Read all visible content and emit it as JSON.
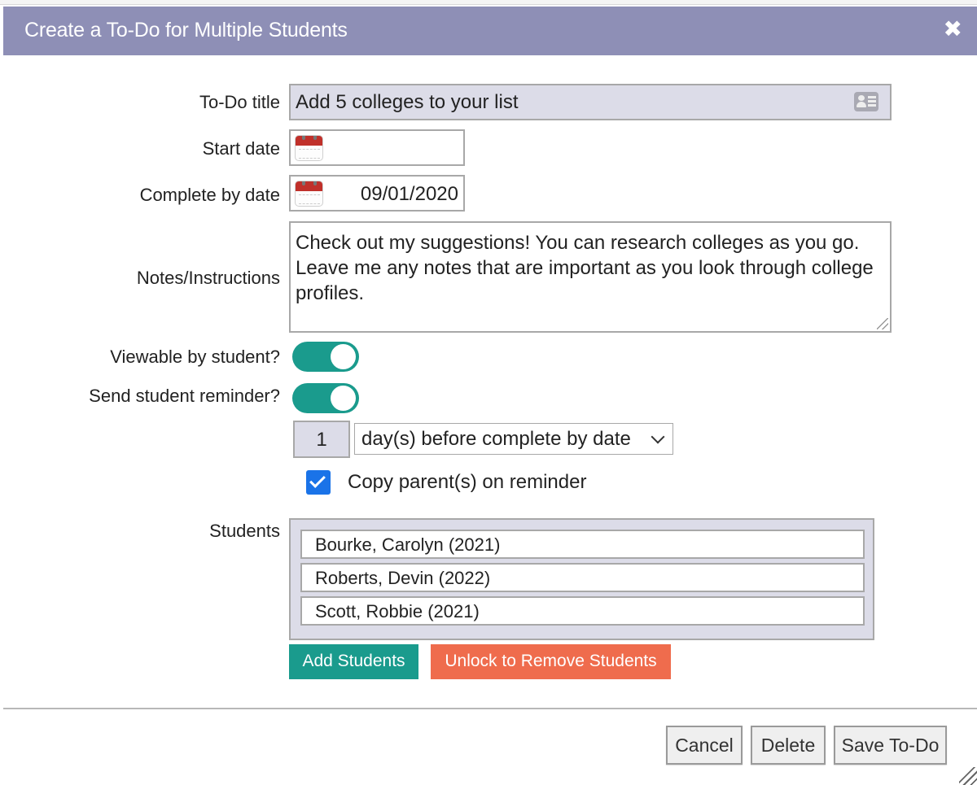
{
  "dialog": {
    "title": "Create a To-Do for Multiple Students",
    "close_symbol": "✖"
  },
  "form": {
    "todo_title_label": "To-Do title",
    "todo_title_value": "Add 5 colleges to your list",
    "start_date_label": "Start date",
    "start_date_value": "",
    "complete_by_label": "Complete by date",
    "complete_by_value": "09/01/2020",
    "notes_label": "Notes/Instructions",
    "notes_value": "Check out my suggestions! You can research colleges as you go. Leave me any notes that are important as you look through college profiles.",
    "viewable_label": "Viewable by student?",
    "viewable_on": true,
    "reminder_label": "Send student reminder?",
    "reminder_on": true,
    "reminder_days_value": "1",
    "reminder_timing_selected": "day(s) before complete by date",
    "copy_parents_label": "Copy parent(s) on reminder",
    "copy_parents_checked": true,
    "students_label": "Students"
  },
  "students": [
    "Bourke, Carolyn (2021)",
    "Roberts, Devin (2022)",
    "Scott, Robbie (2021)"
  ],
  "buttons": {
    "add_students": "Add Students",
    "unlock_remove": "Unlock to Remove Students",
    "cancel": "Cancel",
    "delete": "Delete",
    "save": "Save To-Do"
  },
  "colors": {
    "titlebar": "#8e8fb6",
    "teal": "#1a9b8d",
    "orange": "#ef6c4d",
    "checkbox": "#1a73e8"
  },
  "icons": {
    "close": "close-icon",
    "contact_card": "contact-card-icon",
    "calendar": "calendar-icon",
    "chevron": "chevron-down-icon",
    "checkmark": "checkmark-icon"
  }
}
